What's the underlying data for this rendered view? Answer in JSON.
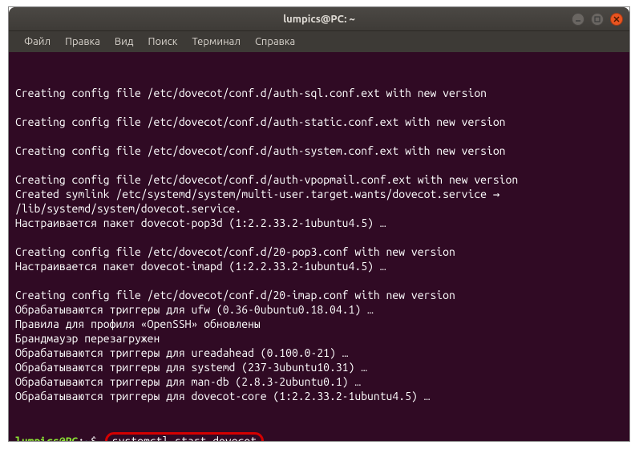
{
  "window": {
    "title": "lumpics@PC: ~"
  },
  "menu": {
    "file": "Файл",
    "edit": "Правка",
    "view": "Вид",
    "search": "Поиск",
    "terminal": "Терминал",
    "help": "Справка"
  },
  "terminal": {
    "output": [
      "Creating config file /etc/dovecot/conf.d/auth-sql.conf.ext with new version",
      "",
      "Creating config file /etc/dovecot/conf.d/auth-static.conf.ext with new version",
      "",
      "Creating config file /etc/dovecot/conf.d/auth-system.conf.ext with new version",
      "",
      "Creating config file /etc/dovecot/conf.d/auth-vpopmail.conf.ext with new version",
      "Created symlink /etc/systemd/system/multi-user.target.wants/dovecot.service → /lib/systemd/system/dovecot.service.",
      "Настраивается пакет dovecot-pop3d (1:2.2.33.2-1ubuntu4.5) …",
      "",
      "Creating config file /etc/dovecot/conf.d/20-pop3.conf with new version",
      "Настраивается пакет dovecot-imapd (1:2.2.33.2-1ubuntu4.5) …",
      "",
      "Creating config file /etc/dovecot/conf.d/20-imap.conf with new version",
      "Обрабатываются триггеры для ufw (0.36-0ubuntu0.18.04.1) …",
      "Правила для профиля «OpenSSH» обновлены",
      "Брандмауэр перезагружен",
      "Обрабатываются триггеры для ureadahead (0.100.0-21) …",
      "Обрабатываются триггеры для systemd (237-3ubuntu10.31) …",
      "Обрабатываются триггеры для man-db (2.8.3-2ubuntu0.1) …",
      "Обрабатываются триггеры для dovecot-core (1:2.2.33.2-1ubuntu4.5) …"
    ],
    "prompt": {
      "user": "lumpics@PC",
      "sep": ":",
      "path": "~",
      "symbol": "$",
      "command": "systemctl start dovecot"
    }
  }
}
